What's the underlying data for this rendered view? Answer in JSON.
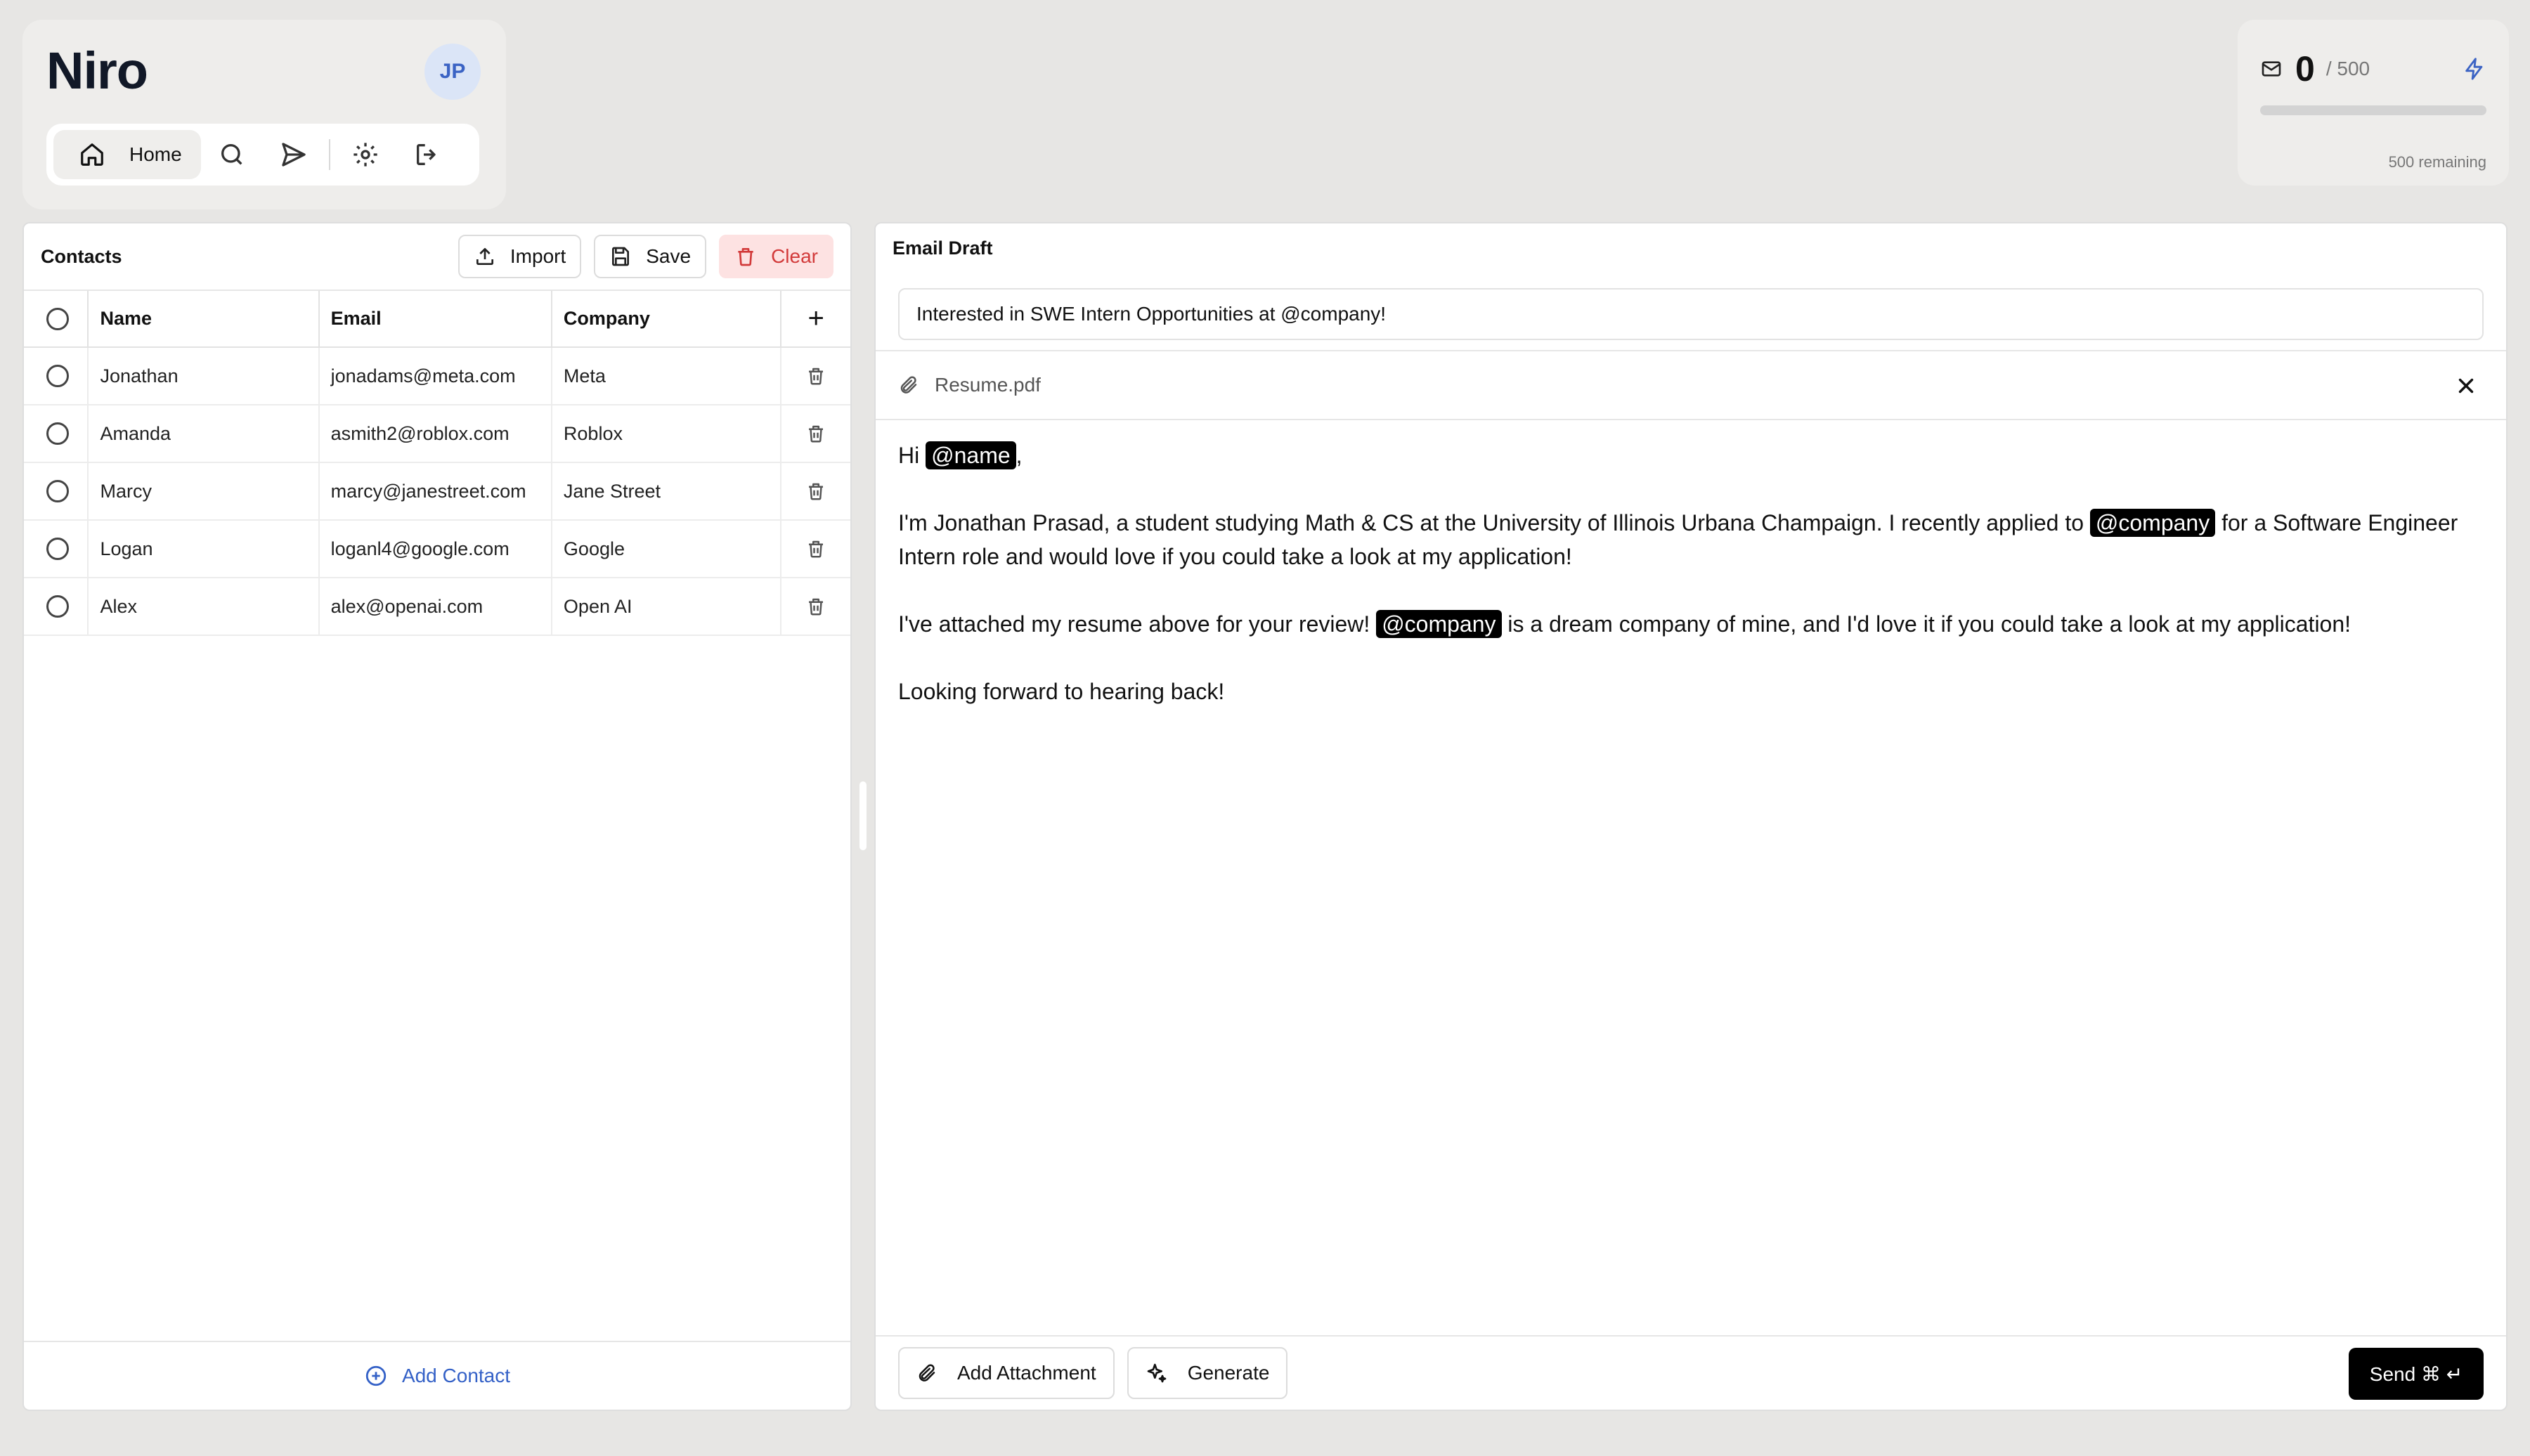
{
  "app": {
    "title": "Niro",
    "avatar_initials": "JP"
  },
  "nav": {
    "home_label": "Home",
    "icons": [
      "home-icon",
      "search-icon",
      "send-icon",
      "gear-icon",
      "logout-icon"
    ]
  },
  "quota": {
    "count": "0",
    "total": "/ 500",
    "remaining": "500 remaining",
    "used_fraction": 0,
    "accent": "#3b63c4"
  },
  "contacts": {
    "title": "Contacts",
    "import_label": "Import",
    "save_label": "Save",
    "clear_label": "Clear",
    "columns": {
      "name": "Name",
      "email": "Email",
      "company": "Company",
      "add": "+"
    },
    "rows": [
      {
        "name": "Jonathan",
        "email": "jonadams@meta.com",
        "company": "Meta"
      },
      {
        "name": "Amanda",
        "email": "asmith2@roblox.com",
        "company": "Roblox"
      },
      {
        "name": "Marcy",
        "email": "marcy@janestreet.com",
        "company": "Jane Street"
      },
      {
        "name": "Logan",
        "email": "loganl4@google.com",
        "company": "Google"
      },
      {
        "name": "Alex",
        "email": "alex@openai.com",
        "company": "Open AI"
      }
    ],
    "add_contact_label": "Add Contact"
  },
  "draft": {
    "title": "Email Draft",
    "subject": "Interested in SWE Intern Opportunities at @company!",
    "attachment_name": "Resume.pdf",
    "body": {
      "greeting_prefix": "Hi ",
      "name_tag": "@name",
      "greeting_suffix": ",",
      "p1_a": "I'm Jonathan Prasad, a student studying Math & CS at the University of Illinois Urbana Champaign. I recently applied to ",
      "p1_tag": "@company",
      "p1_b": " for a Software Engineer Intern role and would love if you could take a look at my application!",
      "p2_a": "I've attached my resume above for your review! ",
      "p2_tag": "@company",
      "p2_b": " is a dream company of mine, and I'd love it if you could take a look at my application!",
      "p3": "Looking forward to hearing back!"
    },
    "add_attachment_label": "Add Attachment",
    "generate_label": "Generate",
    "send_label": "Send ⌘ ↵"
  },
  "colors": {
    "accent_blue": "#3461c7",
    "danger": "#d23a3a",
    "background": "#e7e6e4"
  }
}
